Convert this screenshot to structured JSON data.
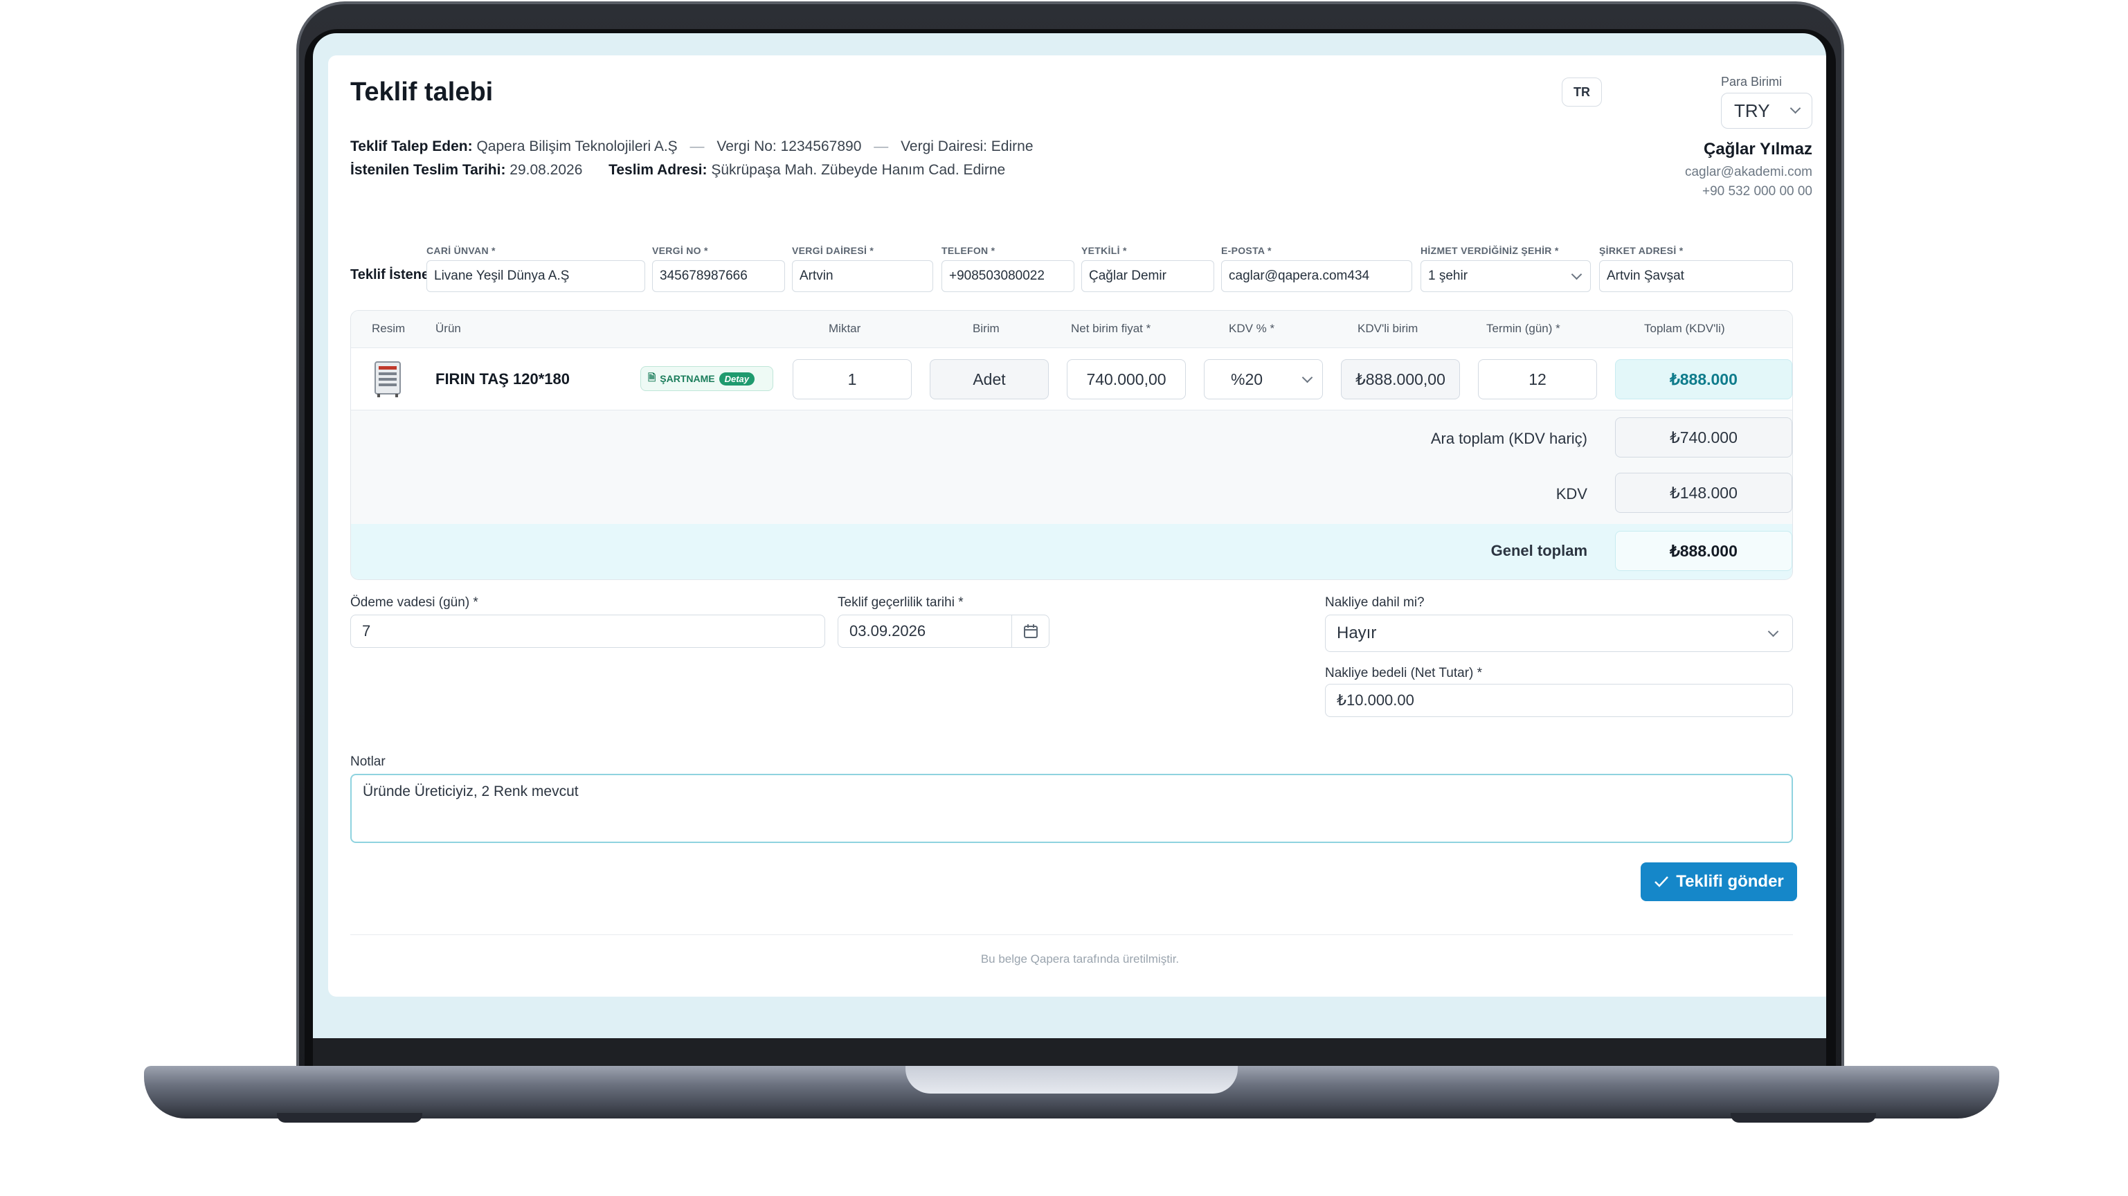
{
  "page": {
    "title": "Teklif talebi",
    "language": "TR",
    "currency_label": "Para Birimi",
    "currency_value": "TRY"
  },
  "requester": {
    "by_label": "Teklif Talep Eden:",
    "company": "Qapera Bilişim Teknolojileri A.Ş",
    "tax_no": "Vergi No: 1234567890",
    "tax_office": "Vergi Dairesi: Edirne",
    "delivery_date_label": "İstenilen Teslim Tarihi:",
    "delivery_date": "29.08.2026",
    "delivery_address_label": "Teslim Adresi:",
    "delivery_address": "Şükrüpaşa Mah. Zübeyde Hanım Cad. Edirne"
  },
  "user": {
    "name": "Çağlar Yılmaz",
    "email": "caglar@akademi.com",
    "phone": "+90 532 000 00 00"
  },
  "supplier": {
    "row_label": "Teklif İstenen:",
    "fields": [
      {
        "label": "CARİ ÜNVAN *",
        "value": "Livane Yeşil Dünya A.Ş"
      },
      {
        "label": "VERGİ NO *",
        "value": "345678987666"
      },
      {
        "label": "VERGİ DAİRESİ *",
        "value": "Artvin"
      },
      {
        "label": "TELEFON *",
        "value": "+908503080022"
      },
      {
        "label": "YETKİLİ *",
        "value": "Çağlar Demir"
      },
      {
        "label": "E-POSTA *",
        "value": "caglar@qapera.com434"
      },
      {
        "label": "HİZMET VERDİĞİNİZ ŞEHİR *",
        "value": "1 şehir"
      },
      {
        "label": "ŞİRKET ADRESİ *",
        "value": "Artvin Şavşat"
      }
    ]
  },
  "table": {
    "headers": {
      "image": "Resim",
      "product": "Ürün",
      "qty": "Miktar",
      "unit": "Birim",
      "net_price": "Net birim fiyat *",
      "vat": "KDV % *",
      "vat_price": "KDV'li birim",
      "term": "Termin (gün) *",
      "total": "Toplam (KDV'li)"
    },
    "row": {
      "product": "FIRIN TAŞ 120*180",
      "spec_label": "ŞARTNAME",
      "spec_detail": "Detay",
      "qty": "1",
      "unit": "Adet",
      "net_price": "740.000,00",
      "vat": "%20",
      "vat_price": "₺888.000,00",
      "term": "12",
      "total": "₺888.000"
    },
    "summary": {
      "subtotal_label": "Ara toplam (KDV hariç)",
      "subtotal": "₺740.000",
      "vat_label": "KDV",
      "vat": "₺148.000",
      "grand_label": "Genel toplam",
      "grand": "₺888.000"
    }
  },
  "form": {
    "payment_label": "Ödeme vadesi (gün) *",
    "payment_value": "7",
    "validity_label": "Teklif geçerlilik tarihi *",
    "validity_value": "03.09.2026",
    "shipping_label": "Nakliye dahil mi?",
    "shipping_value": "Hayır",
    "shipping_cost_label": "Nakliye bedeli (Net Tutar) *",
    "shipping_cost_value": "₺10.000.00",
    "notes_label": "Notlar",
    "notes_value": "Üründe Üreticiyiz, 2 Renk mevcut"
  },
  "actions": {
    "submit_label": "Teklifi gönder"
  },
  "footer": {
    "note": "Bu belge Qapera tarafında üretilmiştir."
  },
  "colors": {
    "accent": "#1587c9",
    "teal_total": "#0f7c8c",
    "screen_bg": "#dff0f5"
  }
}
